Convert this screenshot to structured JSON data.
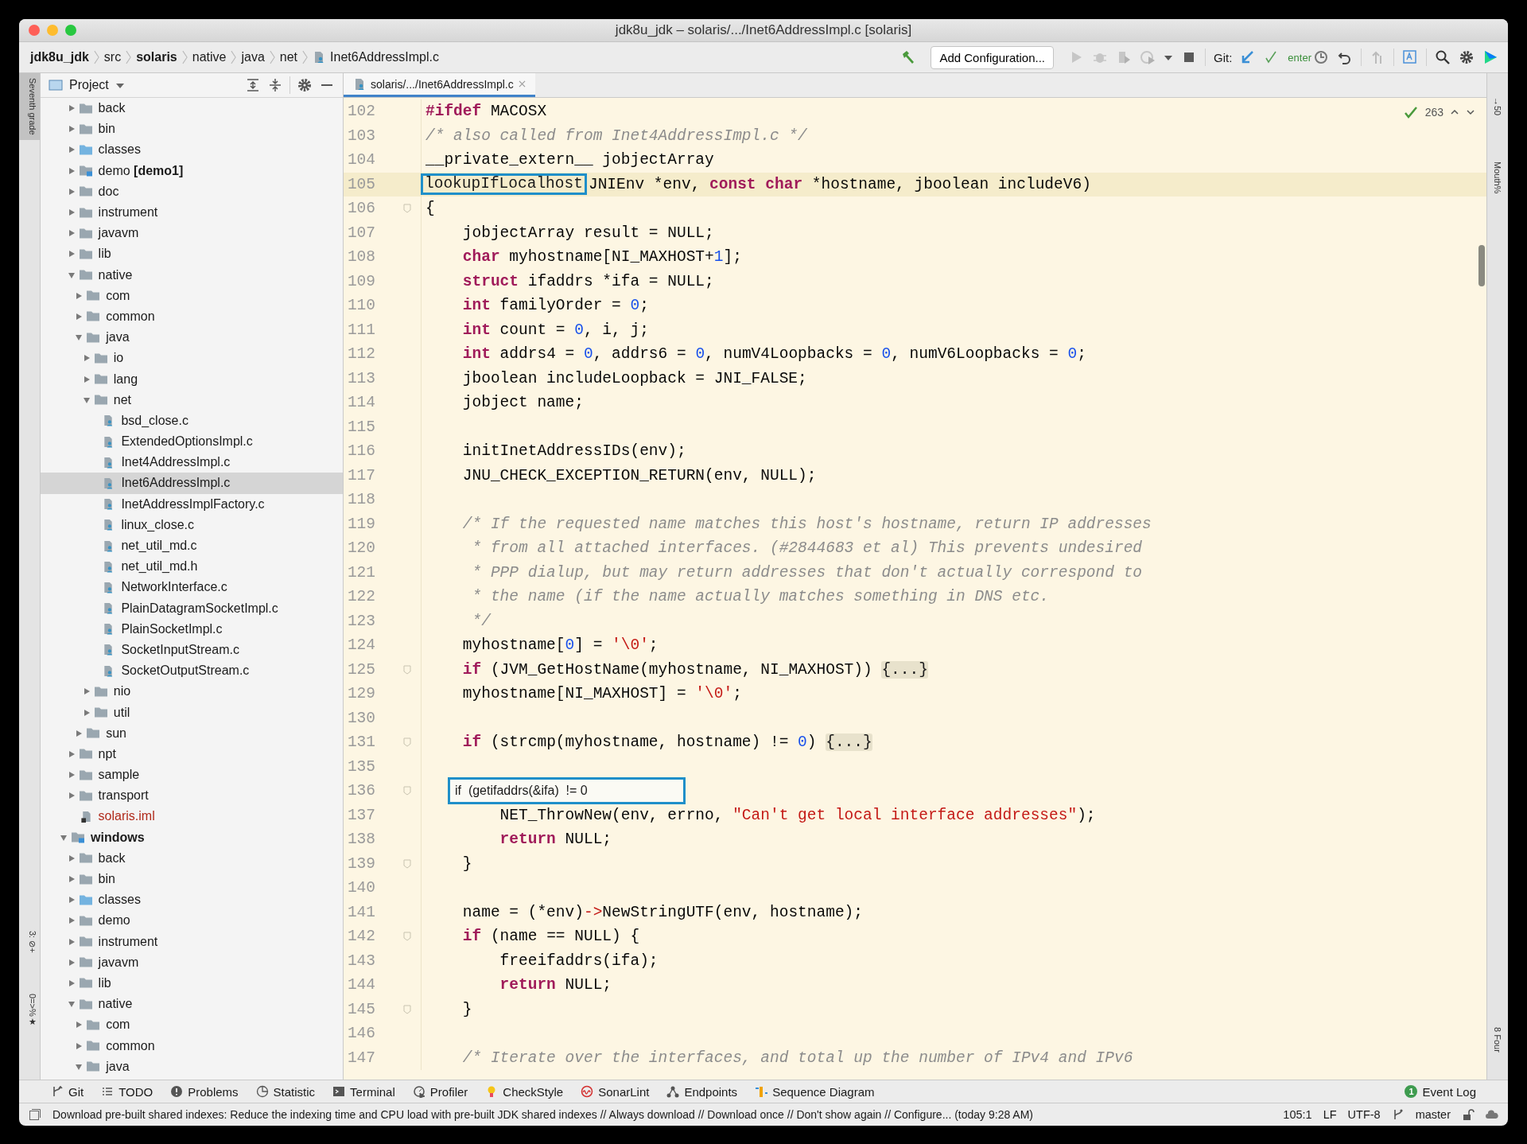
{
  "window": {
    "title": "jdk8u_jdk – solaris/.../Inet6AddressImpl.c [solaris]"
  },
  "breadcrumbs": [
    {
      "label": "jdk8u_jdk",
      "bold": true
    },
    {
      "label": "src",
      "bold": false
    },
    {
      "label": "solaris",
      "bold": true
    },
    {
      "label": "native",
      "bold": false
    },
    {
      "label": "java",
      "bold": false
    },
    {
      "label": "net",
      "bold": false
    },
    {
      "label": "Inet6AddressImpl.c",
      "bold": false,
      "kind": "file"
    }
  ],
  "toolbar": {
    "config_button": "Add Configuration...",
    "git_label": "Git:",
    "git_text": "enter"
  },
  "left_strip": [
    {
      "label": "Seventh grade",
      "selected": true
    },
    {
      "label": "3: ⊘+",
      "selected": false
    },
    {
      "label": "0=>%★",
      "selected": false
    }
  ],
  "right_strip": [
    {
      "label": "→50"
    },
    {
      "label": "Mouth%"
    },
    {
      "label": "8 Four"
    }
  ],
  "project": {
    "title": "Project",
    "tree": [
      {
        "children": [
          {
            "name": "back",
            "kind": "folder",
            "expanded": false,
            "selected": false
          },
          {
            "name": "bin",
            "kind": "folder",
            "expanded": false,
            "selected": false
          },
          {
            "name": "classes",
            "kind": "source",
            "expanded": false,
            "selected": false
          },
          {
            "name": "demo **[demo1]**",
            "kind": "module",
            "expanded": false,
            "selected": false
          },
          {
            "name": "doc",
            "kind": "folder",
            "expanded": false,
            "selected": false
          },
          {
            "name": "instrument",
            "kind": "folder",
            "expanded": false,
            "selected": false
          },
          {
            "name": "javavm",
            "kind": "folder",
            "expanded": false,
            "selected": false
          },
          {
            "name": "lib",
            "kind": "folder",
            "expanded": false,
            "selected": false
          },
          {
            "name": "native",
            "kind": "folder",
            "expanded": true,
            "selected": false,
            "children": [
              {
                "name": "com",
                "kind": "folder",
                "expanded": false,
                "selected": false
              },
              {
                "name": "common",
                "kind": "folder",
                "expanded": false,
                "selected": false
              },
              {
                "name": "java",
                "kind": "folder",
                "expanded": true,
                "selected": false,
                "children": [
                  {
                    "name": "io",
                    "kind": "folder",
                    "expanded": false,
                    "selected": false
                  },
                  {
                    "name": "lang",
                    "kind": "folder",
                    "expanded": false,
                    "selected": false
                  },
                  {
                    "name": "net",
                    "kind": "folder",
                    "expanded": true,
                    "selected": false,
                    "children": [
                      {
                        "name": "bsd_close.c",
                        "kind": "file",
                        "selected": false
                      },
                      {
                        "name": "ExtendedOptionsImpl.c",
                        "kind": "file",
                        "selected": false
                      },
                      {
                        "name": "Inet4AddressImpl.c",
                        "kind": "file",
                        "selected": false
                      },
                      {
                        "name": "Inet6AddressImpl.c",
                        "kind": "file",
                        "selected": true
                      },
                      {
                        "name": "InetAddressImplFactory.c",
                        "kind": "file",
                        "selected": false
                      },
                      {
                        "name": "linux_close.c",
                        "kind": "file",
                        "selected": false
                      },
                      {
                        "name": "net_util_md.c",
                        "kind": "file",
                        "selected": false
                      },
                      {
                        "name": "net_util_md.h",
                        "kind": "file",
                        "selected": false
                      },
                      {
                        "name": "NetworkInterface.c",
                        "kind": "file",
                        "selected": false
                      },
                      {
                        "name": "PlainDatagramSocketImpl.c",
                        "kind": "file",
                        "selected": false
                      },
                      {
                        "name": "PlainSocketImpl.c",
                        "kind": "file",
                        "selected": false
                      },
                      {
                        "name": "SocketInputStream.c",
                        "kind": "file",
                        "selected": false
                      },
                      {
                        "name": "SocketOutputStream.c",
                        "kind": "file",
                        "selected": false
                      }
                    ]
                  },
                  {
                    "name": "nio",
                    "kind": "folder",
                    "expanded": false,
                    "selected": false
                  },
                  {
                    "name": "util",
                    "kind": "folder",
                    "expanded": false,
                    "selected": false
                  }
                ]
              },
              {
                "name": "sun",
                "kind": "folder",
                "expanded": false,
                "selected": false
              }
            ]
          },
          {
            "name": "npt",
            "kind": "folder",
            "expanded": false,
            "selected": false
          },
          {
            "name": "sample",
            "kind": "folder",
            "expanded": false,
            "selected": false
          },
          {
            "name": "transport",
            "kind": "folder",
            "expanded": false,
            "selected": false
          },
          {
            "name": "solaris.iml",
            "kind": "iml",
            "selected": false
          }
        ]
      },
      {
        "name": "windows",
        "kind": "root",
        "expanded": true,
        "selected": false,
        "children": [
          {
            "name": "back",
            "kind": "folder",
            "expanded": false,
            "selected": false
          },
          {
            "name": "bin",
            "kind": "folder",
            "expanded": false,
            "selected": false
          },
          {
            "name": "classes",
            "kind": "source",
            "expanded": false,
            "selected": false
          },
          {
            "name": "demo",
            "kind": "folder",
            "expanded": false,
            "selected": false
          },
          {
            "name": "instrument",
            "kind": "folder",
            "expanded": false,
            "selected": false
          },
          {
            "name": "javavm",
            "kind": "folder",
            "expanded": false,
            "selected": false
          },
          {
            "name": "lib",
            "kind": "folder",
            "expanded": false,
            "selected": false
          },
          {
            "name": "native",
            "kind": "folder",
            "expanded": true,
            "selected": false,
            "children": [
              {
                "name": "com",
                "kind": "folder",
                "expanded": false,
                "selected": false
              },
              {
                "name": "common",
                "kind": "folder",
                "expanded": false,
                "selected": false
              },
              {
                "name": "java",
                "kind": "folder",
                "expanded": true,
                "selected": false
              }
            ]
          }
        ]
      }
    ]
  },
  "editor": {
    "tab": {
      "label": "solaris/.../Inet6AddressImpl.c",
      "selected": true
    },
    "problems": "263",
    "lines": [
      {
        "number": "102",
        "segments": [
          {
            "kind": "keyword",
            "text": "#ifdef"
          },
          {
            "kind": "code",
            "text": " MACOSX"
          }
        ]
      },
      {
        "number": "103",
        "segments": [
          {
            "kind": "comment",
            "text": "/* also called from Inet4AddressImpl.c */"
          }
        ]
      },
      {
        "number": "104",
        "segments": [
          {
            "kind": "code",
            "text": "__private_extern__ jobjectArray"
          }
        ]
      },
      {
        "number": "105",
        "current": true,
        "segments": [
          {
            "kind": "boxed",
            "text": "lookupIfLocalhost"
          },
          {
            "kind": "code",
            "text": "JNIEnv *env, "
          },
          {
            "kind": "keyword",
            "text": "const "
          },
          {
            "kind": "keyword",
            "text": "char"
          },
          {
            "kind": "code",
            "text": " *hostname, jboolean includeV6)"
          }
        ]
      },
      {
        "number": "106",
        "fold": true,
        "segments": [
          {
            "kind": "code",
            "text": "{"
          }
        ]
      },
      {
        "number": "107",
        "segments": [
          {
            "kind": "code",
            "text": "    jobjectArray result = NULL;"
          }
        ]
      },
      {
        "number": "108",
        "segments": [
          {
            "kind": "keyword",
            "text": "    char"
          },
          {
            "kind": "code",
            "text": " myhostname[NI_MAXHOST+"
          },
          {
            "kind": "number",
            "text": "1"
          },
          {
            "kind": "code",
            "text": "];"
          }
        ]
      },
      {
        "number": "109",
        "segments": [
          {
            "kind": "keyword",
            "text": "    struct"
          },
          {
            "kind": "code",
            "text": " ifaddrs *ifa = NULL;"
          }
        ]
      },
      {
        "number": "110",
        "segments": [
          {
            "kind": "keyword",
            "text": "    int"
          },
          {
            "kind": "code",
            "text": " familyOrder = "
          },
          {
            "kind": "number",
            "text": "0"
          },
          {
            "kind": "code",
            "text": ";"
          }
        ]
      },
      {
        "number": "111",
        "segments": [
          {
            "kind": "keyword",
            "text": "    int"
          },
          {
            "kind": "code",
            "text": " count = "
          },
          {
            "kind": "number",
            "text": "0"
          },
          {
            "kind": "code",
            "text": ", i, j;"
          }
        ]
      },
      {
        "number": "112",
        "segments": [
          {
            "kind": "keyword",
            "text": "    int"
          },
          {
            "kind": "code",
            "text": " addrs4 = "
          },
          {
            "kind": "number",
            "text": "0"
          },
          {
            "kind": "code",
            "text": ", addrs6 = "
          },
          {
            "kind": "number",
            "text": "0"
          },
          {
            "kind": "code",
            "text": ", numV4Loopbacks = "
          },
          {
            "kind": "number",
            "text": "0"
          },
          {
            "kind": "code",
            "text": ", numV6Loopbacks = "
          },
          {
            "kind": "number",
            "text": "0"
          },
          {
            "kind": "code",
            "text": ";"
          }
        ]
      },
      {
        "number": "113",
        "segments": [
          {
            "kind": "code",
            "text": "    jboolean includeLoopback = JNI_FALSE;"
          }
        ]
      },
      {
        "number": "114",
        "segments": [
          {
            "kind": "code",
            "text": "    jobject name;"
          }
        ]
      },
      {
        "number": "115"
      },
      {
        "number": "116",
        "segments": [
          {
            "kind": "code",
            "text": "    initInetAddressIDs(env);"
          }
        ]
      },
      {
        "number": "117",
        "segments": [
          {
            "kind": "code",
            "text": "    JNU_CHECK_EXCEPTION_RETURN(env, NULL);"
          }
        ]
      },
      {
        "number": "118"
      },
      {
        "number": "119",
        "segments": [
          {
            "kind": "comment",
            "text": "    /* If the requested name matches this host's hostname, return IP addresses"
          }
        ]
      },
      {
        "number": "120",
        "segments": [
          {
            "kind": "comment",
            "text": "     * from all attached interfaces. (#2844683 et al) This prevents undesired"
          }
        ]
      },
      {
        "number": "121",
        "segments": [
          {
            "kind": "comment",
            "text": "     * PPP dialup, but may return addresses that don't actually correspond to"
          }
        ]
      },
      {
        "number": "122",
        "segments": [
          {
            "kind": "comment",
            "text": "     * the name (if the name actually matches something in DNS etc."
          }
        ]
      },
      {
        "number": "123",
        "segments": [
          {
            "kind": "comment",
            "text": "     */"
          }
        ]
      },
      {
        "number": "124",
        "segments": [
          {
            "kind": "code",
            "text": "    myhostname["
          },
          {
            "kind": "number",
            "text": "0"
          },
          {
            "kind": "code",
            "text": "] = "
          },
          {
            "kind": "string",
            "text": "'\\0'"
          },
          {
            "kind": "code",
            "text": ";"
          }
        ]
      },
      {
        "number": "125",
        "fold": true,
        "segments": [
          {
            "kind": "keyword",
            "text": "    if"
          },
          {
            "kind": "code",
            "text": " (JVM_GetHostName(myhostname, NI_MAXHOST)) "
          },
          {
            "kind": "folded",
            "text": "{...}"
          }
        ]
      },
      {
        "number": "129",
        "segments": [
          {
            "kind": "code",
            "text": "    myhostname[NI_MAXHOST] = "
          },
          {
            "kind": "string",
            "text": "'\\0'"
          },
          {
            "kind": "code",
            "text": ";"
          }
        ]
      },
      {
        "number": "130"
      },
      {
        "number": "131",
        "fold": true,
        "segments": [
          {
            "kind": "keyword",
            "text": "    if"
          },
          {
            "kind": "code",
            "text": " (strcmp(myhostname, hostname) != "
          },
          {
            "kind": "number",
            "text": "0"
          },
          {
            "kind": "code",
            "text": ") "
          },
          {
            "kind": "folded",
            "text": "{...}"
          }
        ]
      },
      {
        "number": "135"
      },
      {
        "number": "136",
        "fold": true,
        "segments": [
          {
            "kind": "hint",
            "text": "if  (getifaddrs(&ifa)  != 0"
          }
        ]
      },
      {
        "number": "137",
        "segments": [
          {
            "kind": "code",
            "text": "        NET_ThrowNew(env, errno, "
          },
          {
            "kind": "string",
            "text": "\"Can't get local interface addresses\""
          },
          {
            "kind": "code",
            "text": ");"
          }
        ]
      },
      {
        "number": "138",
        "segments": [
          {
            "kind": "keyword",
            "text": "        return"
          },
          {
            "kind": "code",
            "text": " NULL;"
          }
        ]
      },
      {
        "number": "139",
        "fold": true,
        "segments": [
          {
            "kind": "code",
            "text": "    }"
          }
        ]
      },
      {
        "number": "140"
      },
      {
        "number": "141",
        "segments": [
          {
            "kind": "code",
            "text": "    name = (*env)"
          },
          {
            "kind": "operator",
            "text": "->"
          },
          {
            "kind": "code",
            "text": "NewStringUTF(env, hostname);"
          }
        ]
      },
      {
        "number": "142",
        "fold": true,
        "segments": [
          {
            "kind": "keyword",
            "text": "    if"
          },
          {
            "kind": "code",
            "text": " (name == NULL) {"
          }
        ]
      },
      {
        "number": "143",
        "segments": [
          {
            "kind": "code",
            "text": "        freeifaddrs(ifa);"
          }
        ]
      },
      {
        "number": "144",
        "segments": [
          {
            "kind": "keyword",
            "text": "        return"
          },
          {
            "kind": "code",
            "text": " NULL;"
          }
        ]
      },
      {
        "number": "145",
        "fold": true,
        "segments": [
          {
            "kind": "code",
            "text": "    }"
          }
        ]
      },
      {
        "number": "146"
      },
      {
        "number": "147",
        "segments": [
          {
            "kind": "comment",
            "text": "    /* Iterate over the interfaces, and total up the number of IPv4 and IPv6"
          }
        ]
      }
    ]
  },
  "tool_windows": [
    {
      "label": "Git"
    },
    {
      "label": "TODO"
    },
    {
      "label": "Problems"
    },
    {
      "label": "Statistic"
    },
    {
      "label": "Terminal"
    },
    {
      "label": "Profiler"
    },
    {
      "label": "CheckStyle"
    },
    {
      "label": "SonarLint"
    },
    {
      "label": "Endpoints"
    },
    {
      "label": "Sequence Diagram"
    }
  ],
  "event_log": {
    "count": "1",
    "label": "Event Log"
  },
  "status_bar": {
    "message": "Download pre-built shared indexes: Reduce the indexing time and CPU load with pre-built JDK shared indexes // Always download // Download once // Don't show again // Configure... (today 9:28 AM)",
    "position": "105:1",
    "line_separator": "LF",
    "encoding": "UTF-8",
    "branch": "master"
  }
}
